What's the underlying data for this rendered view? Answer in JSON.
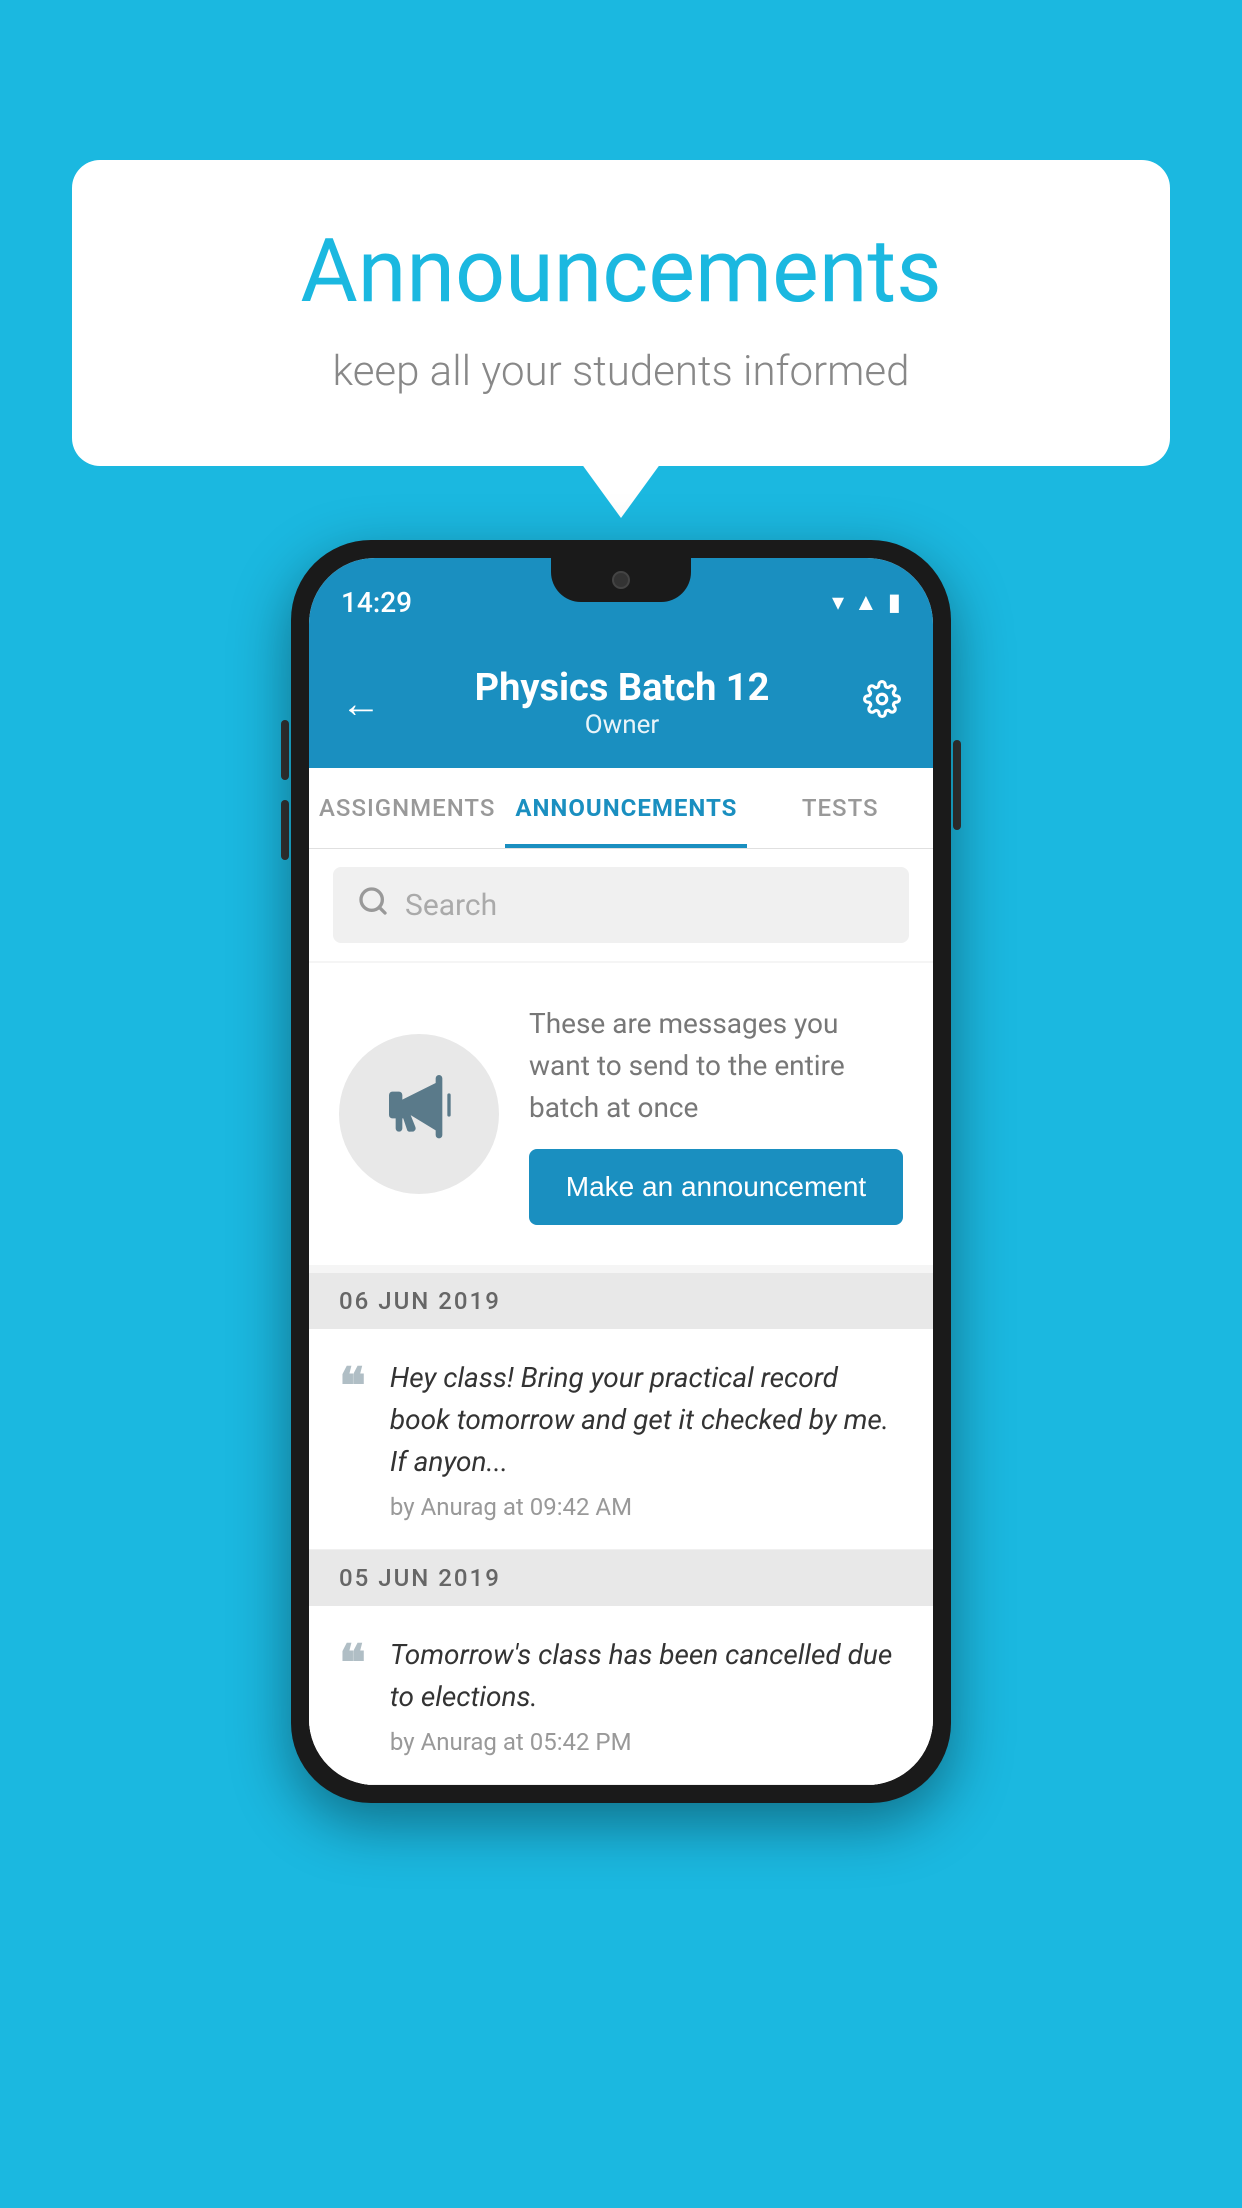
{
  "background_color": "#1bb8e0",
  "speech_bubble": {
    "title": "Announcements",
    "subtitle": "keep all your students informed"
  },
  "phone": {
    "status_bar": {
      "time": "14:29"
    },
    "header": {
      "title": "Physics Batch 12",
      "subtitle": "Owner",
      "back_label": "←",
      "settings_label": "⚙"
    },
    "tabs": [
      {
        "label": "ASSIGNMENTS",
        "active": false
      },
      {
        "label": "ANNOUNCEMENTS",
        "active": true
      },
      {
        "label": "TESTS",
        "active": false
      }
    ],
    "search": {
      "placeholder": "Search"
    },
    "promo": {
      "text": "These are messages you want to send to the entire batch at once",
      "button_label": "Make an announcement"
    },
    "announcements": [
      {
        "date": "06  JUN  2019",
        "text": "Hey class! Bring your practical record book tomorrow and get it checked by me. If anyon...",
        "meta": "by Anurag at 09:42 AM"
      },
      {
        "date": "05  JUN  2019",
        "text": "Tomorrow's class has been cancelled due to elections.",
        "meta": "by Anurag at 05:42 PM"
      }
    ]
  }
}
